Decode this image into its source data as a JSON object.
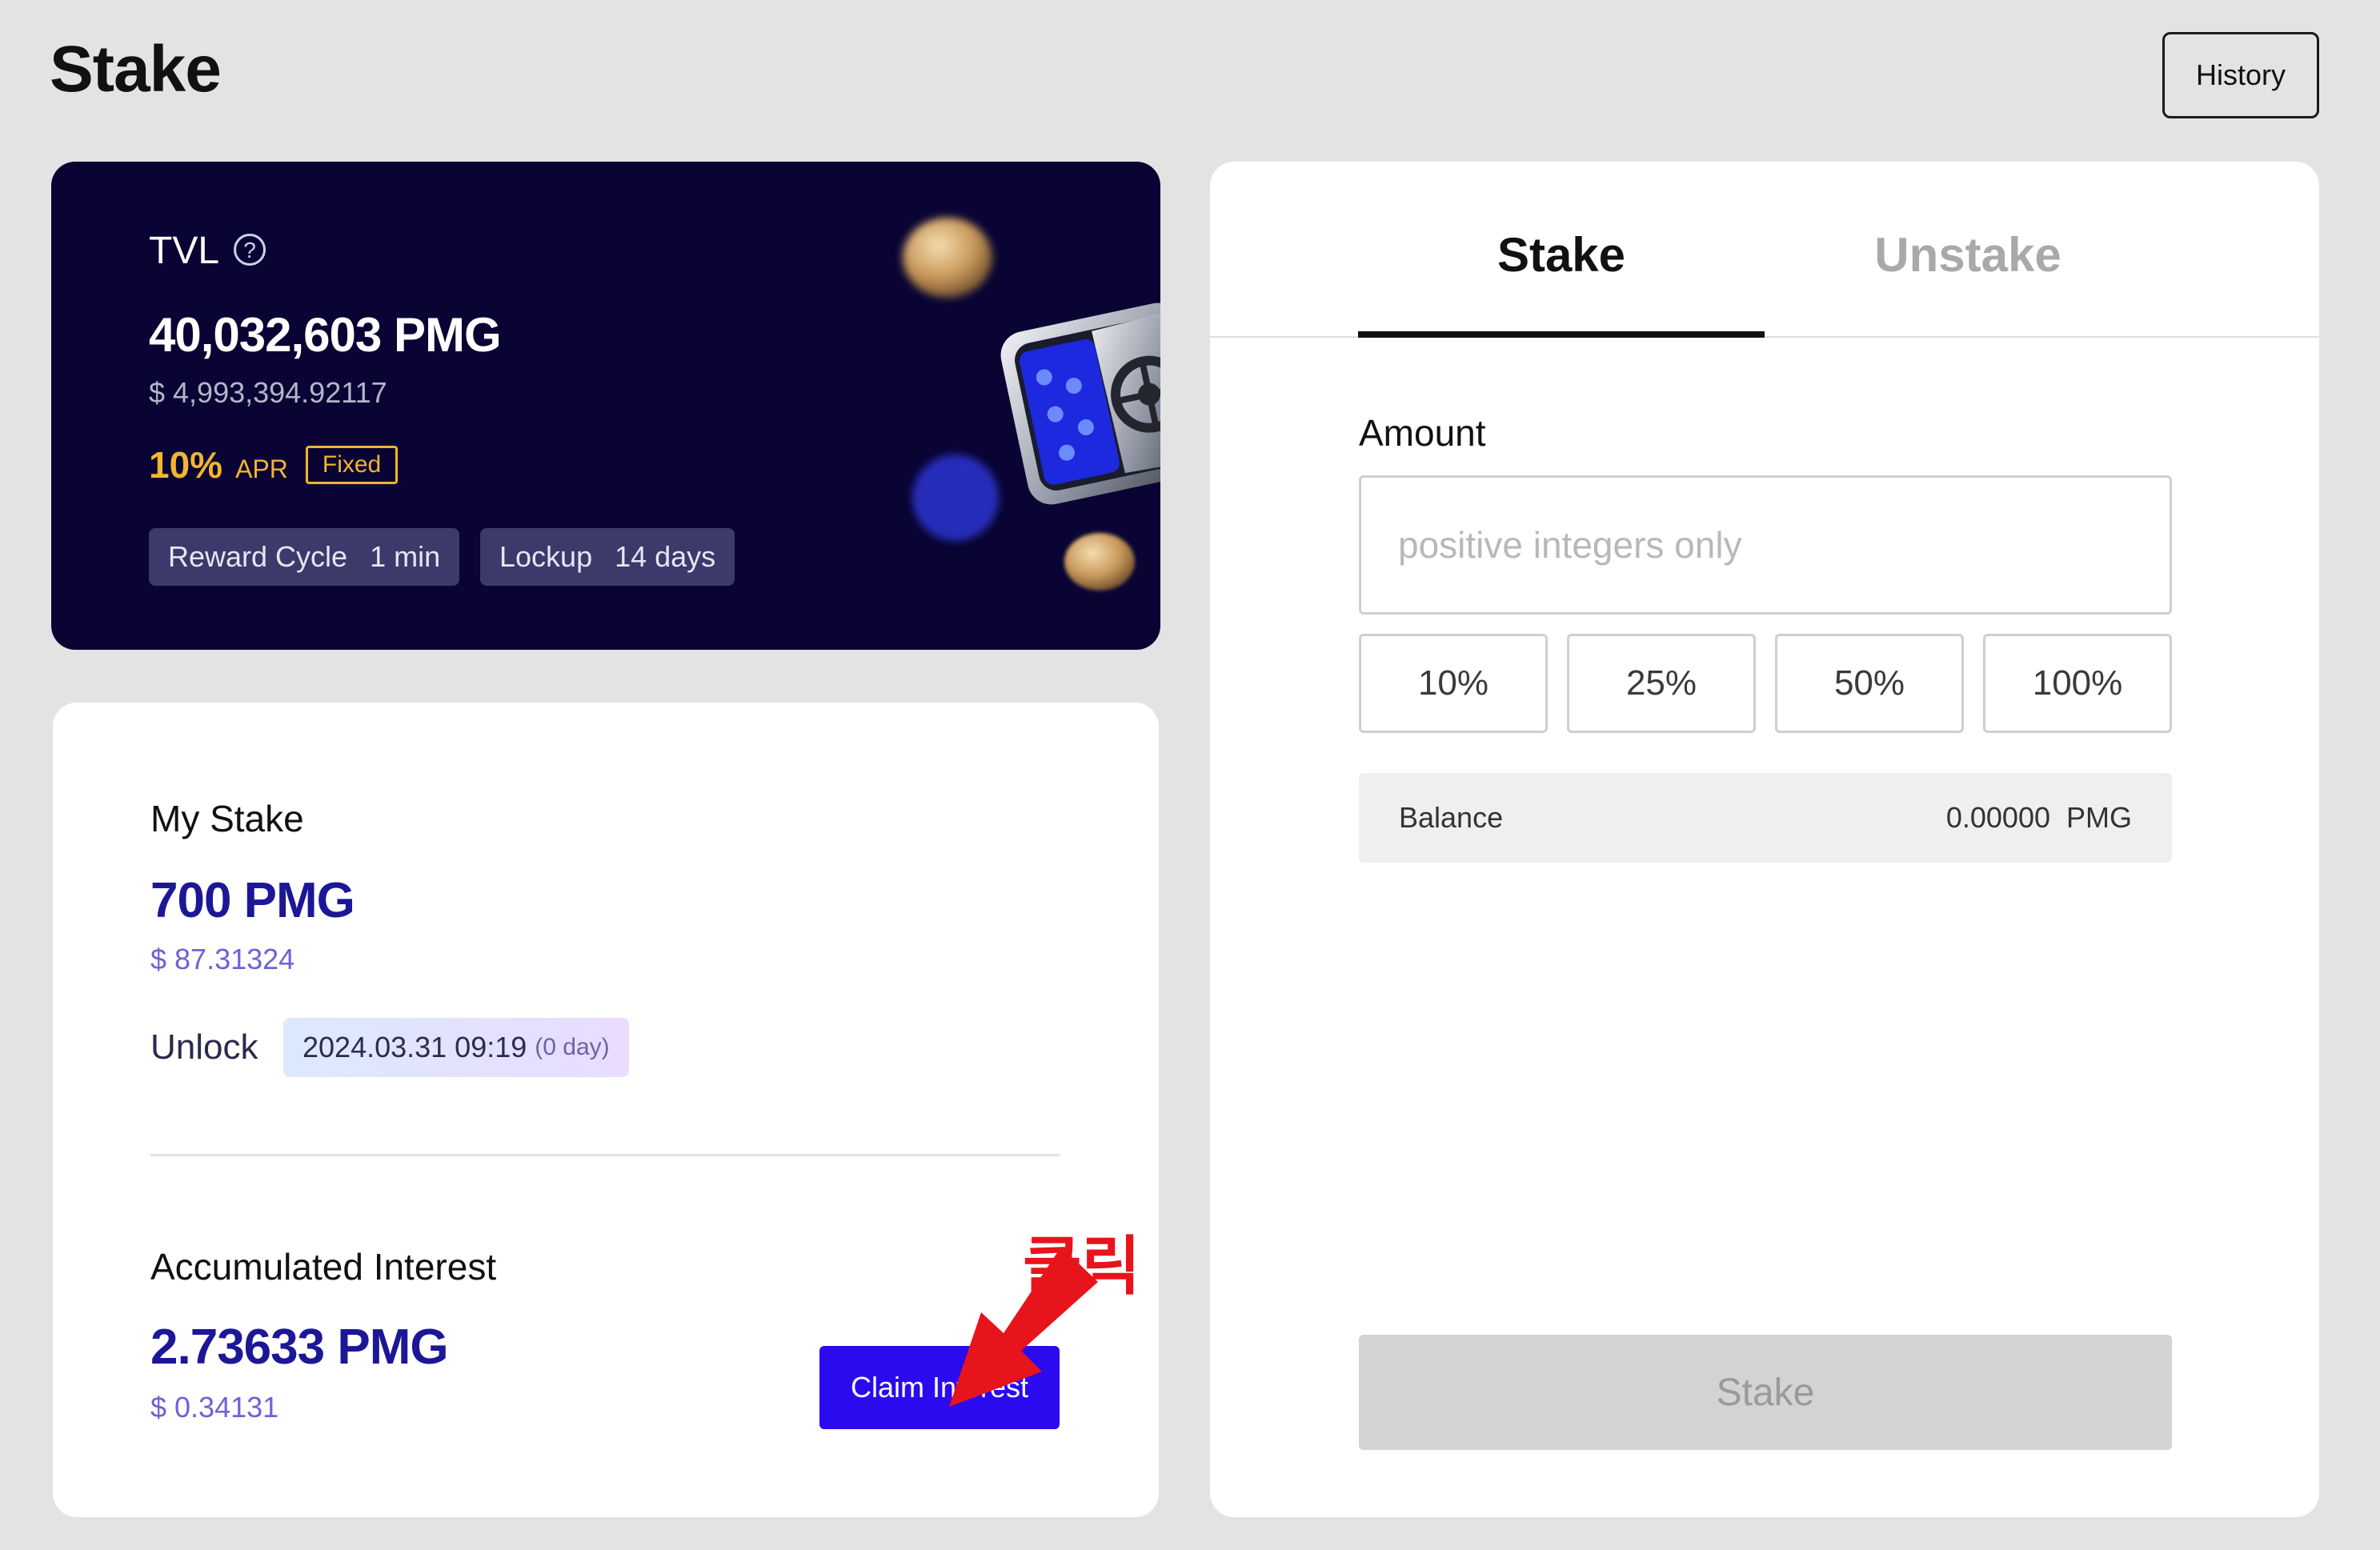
{
  "header": {
    "title": "Stake",
    "history_label": "History"
  },
  "tvl": {
    "label": "TVL",
    "help_icon": "question-circle-icon",
    "value": "40,032,603 PMG",
    "usd": "$ 4,993,394.92117",
    "apr_value": "10%",
    "apr_label": "APR",
    "apr_type": "Fixed",
    "reward_cycle_label": "Reward Cycle",
    "reward_cycle_value": "1 min",
    "lockup_label": "Lockup",
    "lockup_value": "14 days",
    "illustration": "coin-safe-illustration"
  },
  "my_stake": {
    "label": "My Stake",
    "value": "700 PMG",
    "usd": "$ 87.31324",
    "unlock_label": "Unlock",
    "unlock_date": "2024.03.31 09:19",
    "unlock_days": "(0 day)",
    "interest_label": "Accumulated Interest",
    "interest_value": "2.73633 PMG",
    "interest_usd": "$ 0.34131",
    "claim_label": "Claim Interest"
  },
  "annotation": {
    "text": "클릭",
    "icon": "red-arrow-icon",
    "color": "#e8141b"
  },
  "panel": {
    "tabs": [
      {
        "label": "Stake",
        "active": true
      },
      {
        "label": "Unstake",
        "active": false
      }
    ],
    "amount_label": "Amount",
    "amount_value": "",
    "amount_placeholder": "positive integers only",
    "percent_buttons": [
      "10%",
      "25%",
      "50%",
      "100%"
    ],
    "balance_label": "Balance",
    "balance_value": "0.00000  PMG",
    "submit_label": "Stake",
    "submit_enabled": false
  },
  "colors": {
    "background": "#e3e3e3",
    "tvl_card": "#090433",
    "apr_accent": "#f2b431",
    "stake_value": "#1c1797",
    "claim_button": "#2b0aef",
    "disabled_button": "#d3d3d3"
  }
}
